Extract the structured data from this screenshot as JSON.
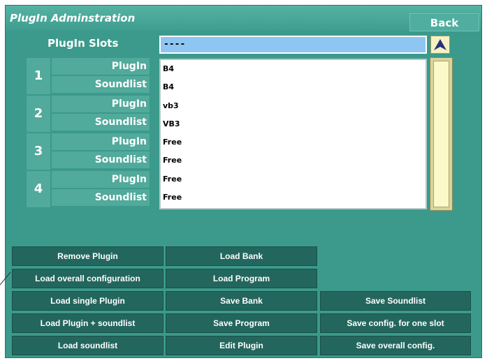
{
  "window": {
    "title": "PlugIn Adminstration",
    "back_label": "Back"
  },
  "slots": {
    "title": "PlugIn Slots",
    "items": [
      {
        "number": "1",
        "plugin_label": "PlugIn",
        "soundlist_label": "Soundlist"
      },
      {
        "number": "2",
        "plugin_label": "PlugIn",
        "soundlist_label": "Soundlist"
      },
      {
        "number": "3",
        "plugin_label": "PlugIn",
        "soundlist_label": "Soundlist"
      },
      {
        "number": "4",
        "plugin_label": "PlugIn",
        "soundlist_label": "Soundlist"
      }
    ]
  },
  "list": {
    "selected": "----",
    "items": [
      "B4",
      "B4",
      "vb3",
      "VB3",
      "Free",
      "Free",
      "Free",
      "Free"
    ]
  },
  "buttons": {
    "remove_plugin": "Remove Plugin",
    "load_overall_config": "Load overall configuration",
    "load_single_plugin": "Load single Plugin",
    "load_plugin_soundlist": "Load Plugin + soundlist",
    "load_soundlist": "Load soundlist",
    "load_bank": "Load Bank",
    "load_program": "Load Program",
    "save_bank": "Save Bank",
    "save_program": "Save Program",
    "edit_plugin": "Edit Plugin",
    "save_soundlist": "Save Soundlist",
    "save_config_one_slot": "Save config. for one slot",
    "save_overall_config": "Save overall config."
  },
  "colors": {
    "panel": "#3b9a8b",
    "slot_bg": "#51aa9b",
    "button_bg": "#23665d",
    "list_header_bg": "#8fc5f2",
    "scrollbar": "#f4f1c2"
  }
}
